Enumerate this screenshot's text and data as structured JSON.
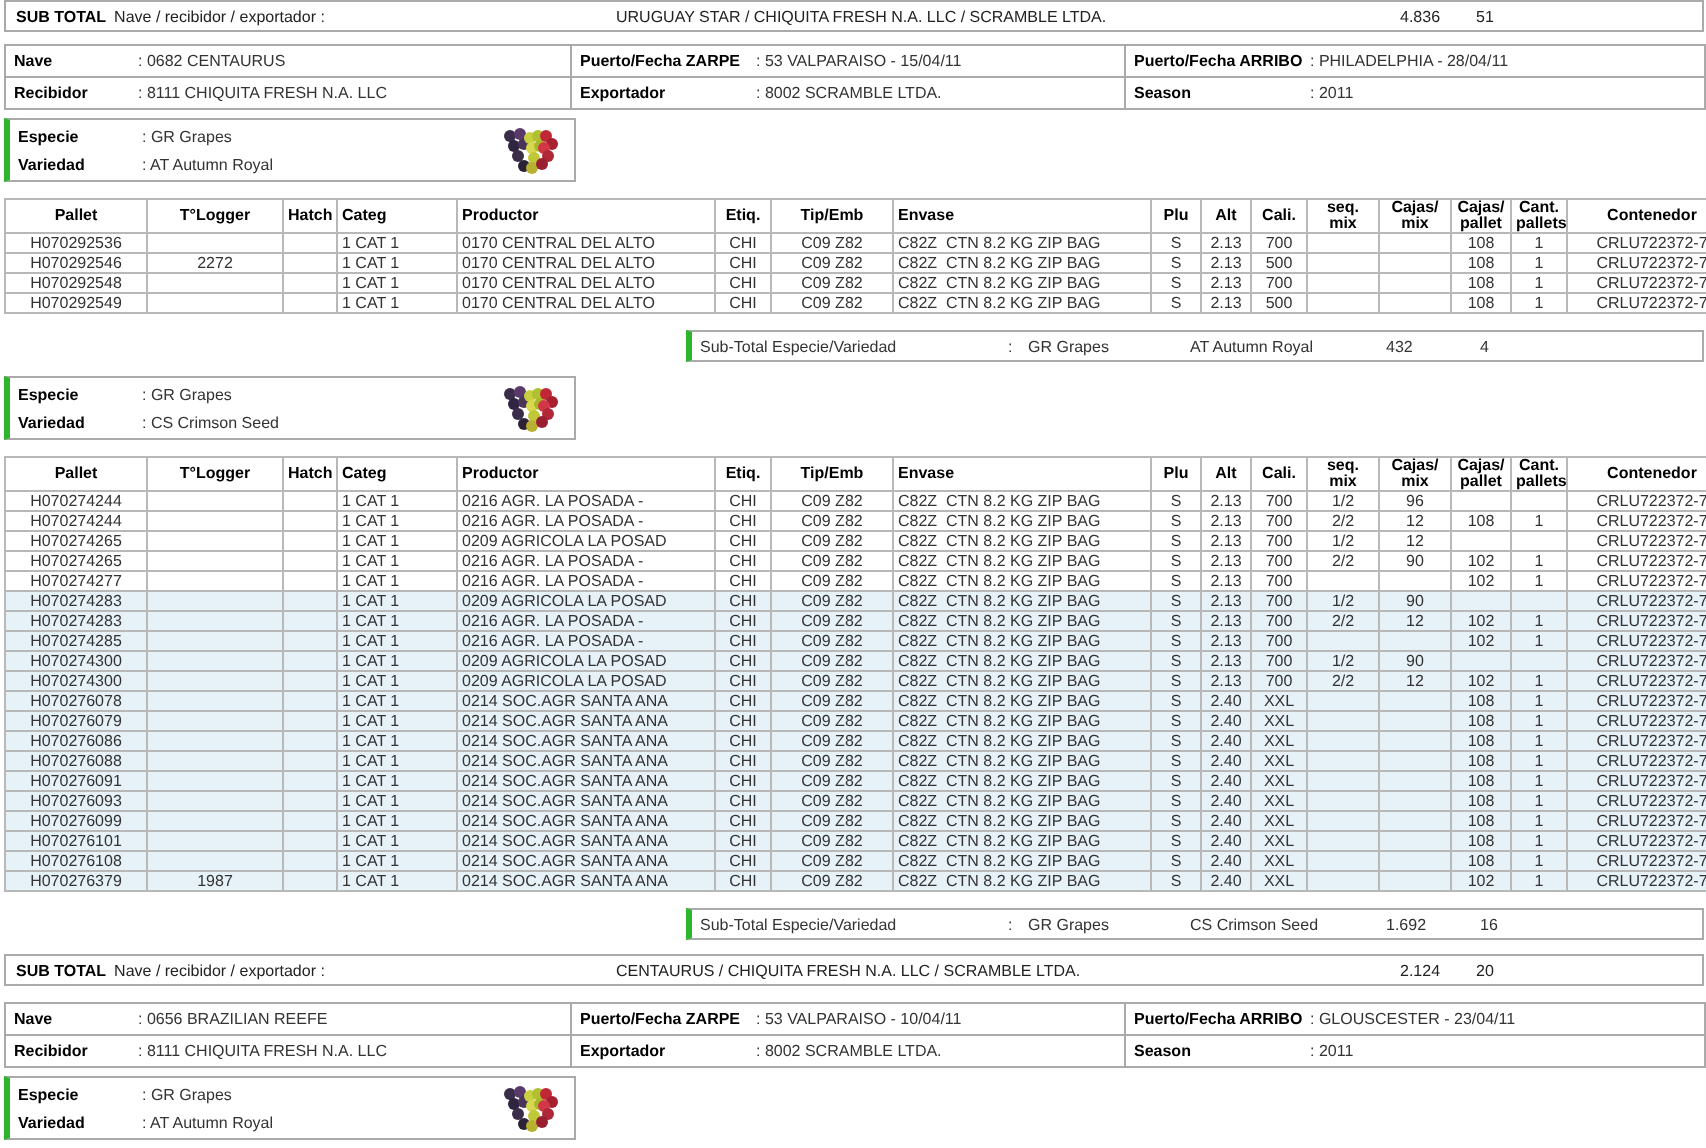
{
  "blocks": [
    {
      "kind": "shipment_subtotal",
      "label": "SUB TOTAL",
      "caption": "Nave / recibidor / exportador :",
      "value": "URUGUAY STAR / CHIQUITA FRESH N.A. LLC / SCRAMBLE LTDA.",
      "total": "4.836",
      "count": "51"
    },
    {
      "kind": "shipment",
      "fields": [
        {
          "label": "Nave",
          "value": ": 0682 CENTAURUS"
        },
        {
          "label": "Puerto/Fecha ZARPE",
          "value": ": 53 VALPARAISO - 15/04/11"
        },
        {
          "label": "Puerto/Fecha ARRIBO",
          "value": ": PHILADELPHIA - 28/04/11"
        },
        {
          "label": "Recibidor",
          "value": ": 8111 CHIQUITA FRESH N.A. LLC"
        },
        {
          "label": "Exportador",
          "value": ": 8002 SCRAMBLE LTDA."
        },
        {
          "label": "Season",
          "value": ": 2011"
        }
      ]
    },
    {
      "kind": "variety",
      "fields": [
        {
          "label": "Especie",
          "value": ": GR Grapes"
        },
        {
          "label": "Variedad",
          "value": ": AT Autumn Royal"
        }
      ]
    },
    {
      "kind": "table",
      "columns": [
        "Pallet",
        "T°Logger",
        "Hatch",
        "Categ",
        "Productor",
        "Etiq.",
        "Tip/Emb",
        "Envase",
        "Plu",
        "Alt",
        "Cali.",
        "seq.\nmix",
        "Cajas/\nmix",
        "Cajas/\npallet",
        "Cant.\npallets",
        "Contenedor"
      ],
      "rows": [
        {
          "shaded": false,
          "cells": [
            "H070292536",
            null,
            null,
            "1 CAT 1",
            "0170 CENTRAL DEL ALTO",
            "CHI",
            "C09 Z82",
            "C82Z  CTN 8.2 KG ZIP BAG",
            "S",
            "2.13",
            "700",
            null,
            null,
            "108",
            "1",
            "CRLU722372-7"
          ]
        },
        {
          "shaded": false,
          "cells": [
            "H070292546",
            "2272",
            null,
            "1 CAT 1",
            "0170 CENTRAL DEL ALTO",
            "CHI",
            "C09 Z82",
            "C82Z  CTN 8.2 KG ZIP BAG",
            "S",
            "2.13",
            "500",
            null,
            null,
            "108",
            "1",
            "CRLU722372-7"
          ]
        },
        {
          "shaded": false,
          "cells": [
            "H070292548",
            null,
            null,
            "1 CAT 1",
            "0170 CENTRAL DEL ALTO",
            "CHI",
            "C09 Z82",
            "C82Z  CTN 8.2 KG ZIP BAG",
            "S",
            "2.13",
            "700",
            null,
            null,
            "108",
            "1",
            "CRLU722372-7"
          ]
        },
        {
          "shaded": false,
          "cells": [
            "H070292549",
            null,
            null,
            "1 CAT 1",
            "0170 CENTRAL DEL ALTO",
            "CHI",
            "C09 Z82",
            "C82Z  CTN 8.2 KG ZIP BAG",
            "S",
            "2.13",
            "500",
            null,
            null,
            "108",
            "1",
            "CRLU722372-7"
          ]
        }
      ]
    },
    {
      "kind": "variety_subtotal",
      "label": "Sub-Total Especie/Variedad",
      "colon": ":",
      "species": "GR Grapes",
      "variety": "AT Autumn Royal",
      "total": "432",
      "count": "4"
    },
    {
      "kind": "variety",
      "fields": [
        {
          "label": "Especie",
          "value": ": GR Grapes"
        },
        {
          "label": "Variedad",
          "value": ": CS Crimson Seed"
        }
      ]
    },
    {
      "kind": "table",
      "columns": [
        "Pallet",
        "T°Logger",
        "Hatch",
        "Categ",
        "Productor",
        "Etiq.",
        "Tip/Emb",
        "Envase",
        "Plu",
        "Alt",
        "Cali.",
        "seq.\nmix",
        "Cajas/\nmix",
        "Cajas/\npallet",
        "Cant.\npallets",
        "Contenedor"
      ],
      "rows": [
        {
          "shaded": false,
          "cells": [
            "H070274244",
            null,
            null,
            "1 CAT 1",
            "0216 AGR. LA POSADA -",
            "CHI",
            "C09 Z82",
            "C82Z  CTN 8.2 KG ZIP BAG",
            "S",
            "2.13",
            "700",
            "1/2",
            "96",
            null,
            null,
            "CRLU722372-7"
          ]
        },
        {
          "shaded": false,
          "cells": [
            "H070274244",
            null,
            null,
            "1 CAT 1",
            "0216 AGR. LA POSADA -",
            "CHI",
            "C09 Z82",
            "C82Z  CTN 8.2 KG ZIP BAG",
            "S",
            "2.13",
            "700",
            "2/2",
            "12",
            "108",
            "1",
            "CRLU722372-7"
          ]
        },
        {
          "shaded": false,
          "cells": [
            "H070274265",
            null,
            null,
            "1 CAT 1",
            "0209 AGRICOLA LA POSAD",
            "CHI",
            "C09 Z82",
            "C82Z  CTN 8.2 KG ZIP BAG",
            "S",
            "2.13",
            "700",
            "1/2",
            "12",
            null,
            null,
            "CRLU722372-7"
          ]
        },
        {
          "shaded": false,
          "cells": [
            "H070274265",
            null,
            null,
            "1 CAT 1",
            "0216 AGR. LA POSADA -",
            "CHI",
            "C09 Z82",
            "C82Z  CTN 8.2 KG ZIP BAG",
            "S",
            "2.13",
            "700",
            "2/2",
            "90",
            "102",
            "1",
            "CRLU722372-7"
          ]
        },
        {
          "shaded": false,
          "cells": [
            "H070274277",
            null,
            null,
            "1 CAT 1",
            "0216 AGR. LA POSADA -",
            "CHI",
            "C09 Z82",
            "C82Z  CTN 8.2 KG ZIP BAG",
            "S",
            "2.13",
            "700",
            null,
            null,
            "102",
            "1",
            "CRLU722372-7"
          ]
        },
        {
          "shaded": true,
          "cells": [
            "H070274283",
            null,
            null,
            "1 CAT 1",
            "0209 AGRICOLA LA POSAD",
            "CHI",
            "C09 Z82",
            "C82Z  CTN 8.2 KG ZIP BAG",
            "S",
            "2.13",
            "700",
            "1/2",
            "90",
            null,
            null,
            "CRLU722372-7"
          ]
        },
        {
          "shaded": true,
          "cells": [
            "H070274283",
            null,
            null,
            "1 CAT 1",
            "0216 AGR. LA POSADA -",
            "CHI",
            "C09 Z82",
            "C82Z  CTN 8.2 KG ZIP BAG",
            "S",
            "2.13",
            "700",
            "2/2",
            "12",
            "102",
            "1",
            "CRLU722372-7"
          ]
        },
        {
          "shaded": true,
          "cells": [
            "H070274285",
            null,
            null,
            "1 CAT 1",
            "0216 AGR. LA POSADA -",
            "CHI",
            "C09 Z82",
            "C82Z  CTN 8.2 KG ZIP BAG",
            "S",
            "2.13",
            "700",
            null,
            null,
            "102",
            "1",
            "CRLU722372-7"
          ]
        },
        {
          "shaded": true,
          "cells": [
            "H070274300",
            null,
            null,
            "1 CAT 1",
            "0209 AGRICOLA LA POSAD",
            "CHI",
            "C09 Z82",
            "C82Z  CTN 8.2 KG ZIP BAG",
            "S",
            "2.13",
            "700",
            "1/2",
            "90",
            null,
            null,
            "CRLU722372-7"
          ]
        },
        {
          "shaded": true,
          "cells": [
            "H070274300",
            null,
            null,
            "1 CAT 1",
            "0209 AGRICOLA LA POSAD",
            "CHI",
            "C09 Z82",
            "C82Z  CTN 8.2 KG ZIP BAG",
            "S",
            "2.13",
            "700",
            "2/2",
            "12",
            "102",
            "1",
            "CRLU722372-7"
          ]
        },
        {
          "shaded": true,
          "cells": [
            "H070276078",
            null,
            null,
            "1 CAT 1",
            "0214 SOC.AGR SANTA ANA",
            "CHI",
            "C09 Z82",
            "C82Z  CTN 8.2 KG ZIP BAG",
            "S",
            "2.40",
            "XXL",
            null,
            null,
            "108",
            "1",
            "CRLU722372-7"
          ]
        },
        {
          "shaded": true,
          "cells": [
            "H070276079",
            null,
            null,
            "1 CAT 1",
            "0214 SOC.AGR SANTA ANA",
            "CHI",
            "C09 Z82",
            "C82Z  CTN 8.2 KG ZIP BAG",
            "S",
            "2.40",
            "XXL",
            null,
            null,
            "108",
            "1",
            "CRLU722372-7"
          ]
        },
        {
          "shaded": true,
          "cells": [
            "H070276086",
            null,
            null,
            "1 CAT 1",
            "0214 SOC.AGR SANTA ANA",
            "CHI",
            "C09 Z82",
            "C82Z  CTN 8.2 KG ZIP BAG",
            "S",
            "2.40",
            "XXL",
            null,
            null,
            "108",
            "1",
            "CRLU722372-7"
          ]
        },
        {
          "shaded": true,
          "cells": [
            "H070276088",
            null,
            null,
            "1 CAT 1",
            "0214 SOC.AGR SANTA ANA",
            "CHI",
            "C09 Z82",
            "C82Z  CTN 8.2 KG ZIP BAG",
            "S",
            "2.40",
            "XXL",
            null,
            null,
            "108",
            "1",
            "CRLU722372-7"
          ]
        },
        {
          "shaded": true,
          "cells": [
            "H070276091",
            null,
            null,
            "1 CAT 1",
            "0214 SOC.AGR SANTA ANA",
            "CHI",
            "C09 Z82",
            "C82Z  CTN 8.2 KG ZIP BAG",
            "S",
            "2.40",
            "XXL",
            null,
            null,
            "108",
            "1",
            "CRLU722372-7"
          ]
        },
        {
          "shaded": true,
          "cells": [
            "H070276093",
            null,
            null,
            "1 CAT 1",
            "0214 SOC.AGR SANTA ANA",
            "CHI",
            "C09 Z82",
            "C82Z  CTN 8.2 KG ZIP BAG",
            "S",
            "2.40",
            "XXL",
            null,
            null,
            "108",
            "1",
            "CRLU722372-7"
          ]
        },
        {
          "shaded": true,
          "cells": [
            "H070276099",
            null,
            null,
            "1 CAT 1",
            "0214 SOC.AGR SANTA ANA",
            "CHI",
            "C09 Z82",
            "C82Z  CTN 8.2 KG ZIP BAG",
            "S",
            "2.40",
            "XXL",
            null,
            null,
            "108",
            "1",
            "CRLU722372-7"
          ]
        },
        {
          "shaded": true,
          "cells": [
            "H070276101",
            null,
            null,
            "1 CAT 1",
            "0214 SOC.AGR SANTA ANA",
            "CHI",
            "C09 Z82",
            "C82Z  CTN 8.2 KG ZIP BAG",
            "S",
            "2.40",
            "XXL",
            null,
            null,
            "108",
            "1",
            "CRLU722372-7"
          ]
        },
        {
          "shaded": true,
          "cells": [
            "H070276108",
            null,
            null,
            "1 CAT 1",
            "0214 SOC.AGR SANTA ANA",
            "CHI",
            "C09 Z82",
            "C82Z  CTN 8.2 KG ZIP BAG",
            "S",
            "2.40",
            "XXL",
            null,
            null,
            "108",
            "1",
            "CRLU722372-7"
          ]
        },
        {
          "shaded": true,
          "cells": [
            "H070276379",
            "1987",
            null,
            "1 CAT 1",
            "0214 SOC.AGR SANTA ANA",
            "CHI",
            "C09 Z82",
            "C82Z  CTN 8.2 KG ZIP BAG",
            "S",
            "2.40",
            "XXL",
            null,
            null,
            "102",
            "1",
            "CRLU722372-7"
          ]
        }
      ]
    },
    {
      "kind": "variety_subtotal",
      "label": "Sub-Total Especie/Variedad",
      "colon": ":",
      "species": "GR Grapes",
      "variety": "CS Crimson Seed",
      "total": "1.692",
      "count": "16"
    },
    {
      "kind": "shipment_subtotal",
      "label": "SUB TOTAL",
      "caption": "Nave / recibidor / exportador :",
      "value": "CENTAURUS / CHIQUITA FRESH N.A. LLC / SCRAMBLE LTDA.",
      "total": "2.124",
      "count": "20"
    },
    {
      "kind": "shipment",
      "fields": [
        {
          "label": "Nave",
          "value": ": 0656 BRAZILIAN REEFE"
        },
        {
          "label": "Puerto/Fecha ZARPE",
          "value": ": 53 VALPARAISO - 10/04/11"
        },
        {
          "label": "Puerto/Fecha ARRIBO",
          "value": ": GLOUSCESTER - 23/04/11"
        },
        {
          "label": "Recibidor",
          "value": ": 8111 CHIQUITA FRESH N.A. LLC"
        },
        {
          "label": "Exportador",
          "value": ": 8002 SCRAMBLE LTDA."
        },
        {
          "label": "Season",
          "value": ": 2011"
        }
      ]
    },
    {
      "kind": "variety",
      "fields": [
        {
          "label": "Especie",
          "value": ": GR Grapes"
        },
        {
          "label": "Variedad",
          "value": ": AT Autumn Royal"
        }
      ]
    }
  ]
}
